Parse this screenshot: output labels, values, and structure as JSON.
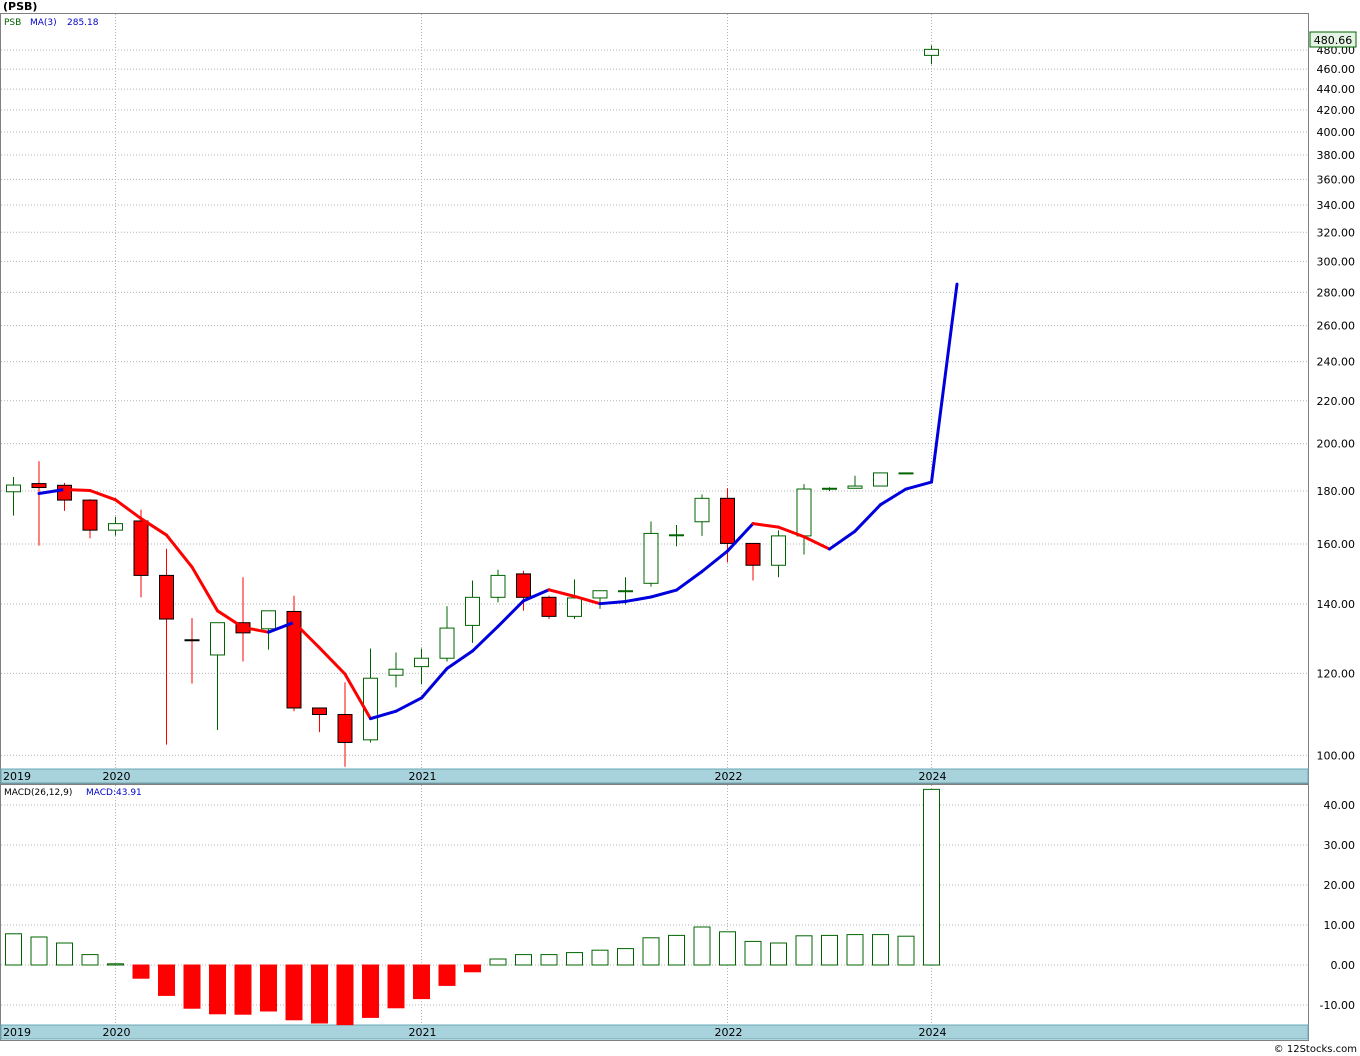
{
  "symbol_title": "(PSB)",
  "legend": {
    "symbol": "PSB",
    "ma_label": "MA(3)",
    "ma_value": "285.18"
  },
  "macd_legend": {
    "label": "MACD(26,12,9)",
    "value_label": "MACD:43.91"
  },
  "last_price_tag": "480.66",
  "footer": "© 12Stocks.com",
  "colors": {
    "up": "#006400",
    "down": "#ff0000",
    "ma_up": "#0000dd",
    "ma_down": "#ff0000",
    "grid": "#b4b4b4",
    "axis_band": "#a8d3dc",
    "price_tag_bg": "#e4f4e4"
  },
  "chart_data": [
    {
      "type": "candlestick",
      "scale": "log",
      "ylim": [
        97,
        520
      ],
      "y_ticks": [
        "100.00",
        "120.00",
        "140.00",
        "160.00",
        "180.00",
        "200.00",
        "220.00",
        "240.00",
        "260.00",
        "280.00",
        "300.00",
        "320.00",
        "340.00",
        "360.00",
        "380.00",
        "400.00",
        "420.00",
        "440.00",
        "460.00",
        "480.00"
      ],
      "x_ticks": [
        {
          "label": "2019",
          "i": 0
        },
        {
          "label": "2020",
          "i": 4
        },
        {
          "label": "2021",
          "i": 16
        },
        {
          "label": "2022",
          "i": 28
        },
        {
          "label": "2024",
          "i": 36
        }
      ],
      "candles": [
        {
          "o": 179.7,
          "h": 185.7,
          "l": 170.4,
          "c": 182.4
        },
        {
          "o": 183.0,
          "h": 192.3,
          "l": 159.4,
          "c": 181.4
        },
        {
          "o": 182.3,
          "h": 183.3,
          "l": 172.2,
          "c": 176.4
        },
        {
          "o": 176.4,
          "h": 176.8,
          "l": 162.0,
          "c": 165.0
        },
        {
          "o": 165.0,
          "h": 170.0,
          "l": 163.0,
          "c": 167.4
        },
        {
          "o": 168.4,
          "h": 172.7,
          "l": 142.1,
          "c": 149.2
        },
        {
          "o": 149.2,
          "h": 158.3,
          "l": 102.4,
          "c": 135.4
        },
        {
          "o": 129.3,
          "h": 135.7,
          "l": 117.3,
          "c": 129.2
        },
        {
          "o": 125.0,
          "h": 134.3,
          "l": 105.8,
          "c": 134.3
        },
        {
          "o": 134.3,
          "h": 148.6,
          "l": 123.2,
          "c": 131.3
        },
        {
          "o": 132.5,
          "h": 137.9,
          "l": 126.5,
          "c": 137.9
        },
        {
          "o": 137.7,
          "h": 142.6,
          "l": 110.3,
          "c": 111.1
        },
        {
          "o": 111.1,
          "h": 111.1,
          "l": 105.3,
          "c": 109.5
        },
        {
          "o": 109.5,
          "h": 117.6,
          "l": 97.5,
          "c": 102.9
        },
        {
          "o": 103.5,
          "h": 126.8,
          "l": 102.9,
          "c": 118.7
        },
        {
          "o": 119.5,
          "h": 125.7,
          "l": 116.3,
          "c": 121.1
        },
        {
          "o": 121.8,
          "h": 126.8,
          "l": 117.1,
          "c": 124.1
        },
        {
          "o": 124.1,
          "h": 139.3,
          "l": 123.2,
          "c": 132.7
        },
        {
          "o": 133.5,
          "h": 147.5,
          "l": 128.4,
          "c": 142.1
        },
        {
          "o": 142.1,
          "h": 151.1,
          "l": 140.5,
          "c": 149.2
        },
        {
          "o": 149.7,
          "h": 150.7,
          "l": 137.9,
          "c": 142.1
        },
        {
          "o": 142.1,
          "h": 142.6,
          "l": 135.4,
          "c": 136.2
        },
        {
          "o": 136.2,
          "h": 147.9,
          "l": 135.4,
          "c": 141.9
        },
        {
          "o": 141.9,
          "h": 144.2,
          "l": 138.5,
          "c": 144.2
        },
        {
          "o": 144.2,
          "h": 148.6,
          "l": 139.8,
          "c": 144.2
        },
        {
          "o": 146.6,
          "h": 168.2,
          "l": 145.5,
          "c": 163.8
        },
        {
          "o": 163.3,
          "h": 166.9,
          "l": 159.2,
          "c": 163.3
        },
        {
          "o": 168.1,
          "h": 178.6,
          "l": 162.9,
          "c": 177.1
        },
        {
          "o": 177.1,
          "h": 181.1,
          "l": 153.6,
          "c": 160.2
        },
        {
          "o": 160.2,
          "h": 160.2,
          "l": 147.5,
          "c": 152.6
        },
        {
          "o": 152.6,
          "h": 164.9,
          "l": 148.6,
          "c": 162.9
        },
        {
          "o": 162.9,
          "h": 182.8,
          "l": 156.3,
          "c": 180.8
        },
        {
          "o": 180.8,
          "h": 181.5,
          "l": 180.0,
          "c": 181.1
        },
        {
          "o": 181.1,
          "h": 186.2,
          "l": 181.1,
          "c": 182.0
        },
        {
          "o": 182.0,
          "h": 187.4,
          "l": 182.0,
          "c": 187.4
        },
        {
          "o": 187.4,
          "h": 187.5,
          "l": 187.4,
          "c": 187.4
        },
        {
          "o": 474.3,
          "h": 485.0,
          "l": 465.0,
          "c": 480.66
        }
      ],
      "ma3": [
        179.0,
        180.6,
        180.2,
        176.5,
        169.3,
        163.2,
        152.0,
        137.9,
        132.9,
        131.5,
        134.4,
        127.0,
        119.8,
        108.5,
        110.3,
        113.6,
        121.3,
        126.1,
        133.2,
        141.0,
        144.5,
        142.4,
        140.1,
        140.8,
        142.2,
        144.4,
        150.5,
        157.5,
        167.4,
        166.1,
        162.6,
        158.2,
        164.6,
        174.6,
        180.8,
        183.6,
        285.18
      ]
    },
    {
      "type": "bar",
      "title": "MACD(26,12,9)",
      "ylim": [
        -15,
        45
      ],
      "y_ticks": [
        "-10.00",
        "0.00",
        "10.00",
        "20.00",
        "30.00",
        "40.00"
      ],
      "x_ticks": [
        {
          "label": "2019",
          "i": 0
        },
        {
          "label": "2020",
          "i": 4
        },
        {
          "label": "2021",
          "i": 16
        },
        {
          "label": "2022",
          "i": 28
        },
        {
          "label": "2024",
          "i": 36
        }
      ],
      "values": [
        7.8,
        7.0,
        5.5,
        2.6,
        0.3,
        -3.3,
        -7.6,
        -10.8,
        -12.2,
        -12.3,
        -11.5,
        -13.7,
        -14.5,
        -14.9,
        -13.1,
        -10.7,
        -8.4,
        -5.1,
        -1.7,
        1.5,
        2.6,
        2.6,
        3.1,
        3.7,
        4.1,
        6.8,
        7.4,
        9.5,
        8.3,
        5.9,
        5.5,
        7.3,
        7.4,
        7.6,
        7.6,
        7.2,
        43.91
      ]
    }
  ]
}
